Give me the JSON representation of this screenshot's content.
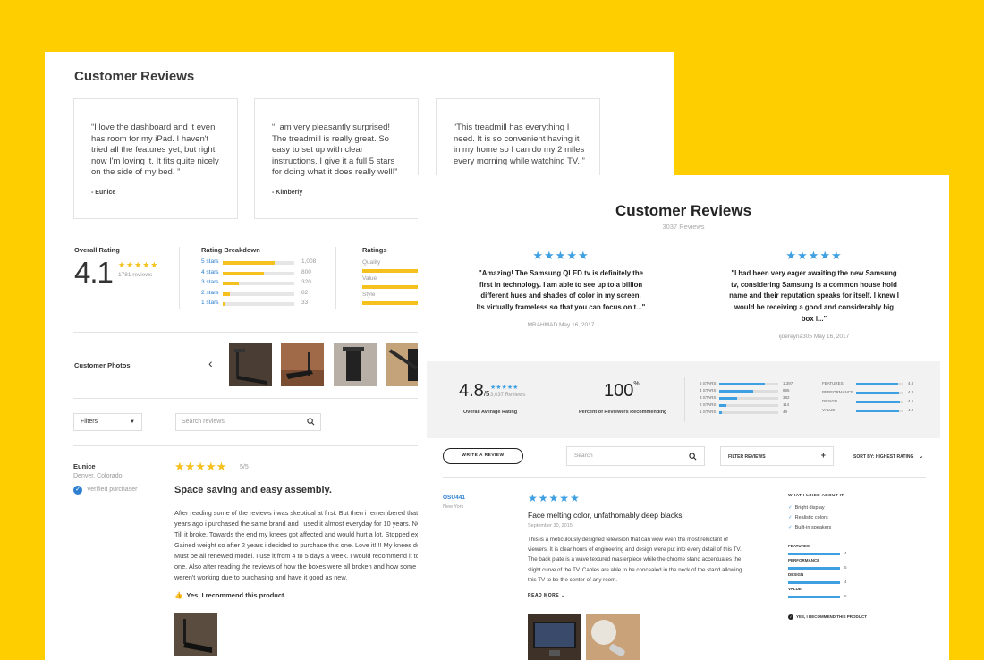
{
  "card1": {
    "title": "Customer Reviews",
    "quotes": [
      {
        "text": "“I love the dashboard and it even has room for my iPad. I haven't tried all the features yet, but right now I'm loving it. It fits quite nicely on the side of my bed. ”",
        "author": "- Eunice"
      },
      {
        "text": "“I am very pleasantly surprised! The treadmill is really great. So easy to set up with clear instructions. I give it a full 5 stars for doing what it does really well!”",
        "author": "- Kimberly"
      },
      {
        "text": "“This treadmill has everything I need. It is so convenient having it in my home so I can do my 2 miles every morning while watching TV. ”",
        "author": ""
      }
    ],
    "overall": {
      "label": "Overall Rating",
      "value": "4.1",
      "stars": "★★★★★",
      "count": "1781 reviews"
    },
    "breakdown": {
      "label": "Rating Breakdown",
      "rows": [
        {
          "label": "5 stars",
          "count": "1,008",
          "fraction": 0.72
        },
        {
          "label": "4 stars",
          "count": "800",
          "fraction": 0.57
        },
        {
          "label": "3 stars",
          "count": "320",
          "fraction": 0.23
        },
        {
          "label": "2 stars",
          "count": "82",
          "fraction": 0.1
        },
        {
          "label": "1 stars",
          "count": "33",
          "fraction": 0.03
        }
      ]
    },
    "ratings": {
      "label": "Ratings",
      "rows": [
        {
          "label": "Quality"
        },
        {
          "label": "Value"
        },
        {
          "label": "Style"
        }
      ]
    },
    "photos": {
      "label": "Customer Photos",
      "prev_icon": "‹"
    },
    "filters": {
      "label": "Filters",
      "arrow": "▼"
    },
    "search": {
      "placeholder": "Search reviews"
    },
    "review": {
      "name": "Eunice",
      "location": "Denver, Colorado",
      "verified": "Verified purchaser",
      "stars": "★★★★★",
      "score": "5/5",
      "title": "Space saving and easy assembly.",
      "body_lines": [
        "After reading some of the reviews i was skeptical at first. But then i remembered that r",
        "years ago i purchased the same brand and i used it almost everyday for 10 years. NO K",
        "Till it broke. Towards the end my knees got affected and would hurt a lot. Stopped exe",
        "Gained weight so after 2 years i decided to purchase this one. Love it!!!! My knees don'",
        "Must be all renewed model. I use it from 4 to 5 days a week. I would recommend it to e",
        "one. Also after reading the reviews of how the boxes were all broken and how some p",
        "weren't working due to purchasing and have it good as new."
      ],
      "recommend": "Yes, I recommend this product."
    }
  },
  "card2": {
    "title": "Customer Reviews",
    "subtitle": "3037 Reviews",
    "quotes": [
      {
        "stars": "★★★★★",
        "text": "\"Amazing! The Samsung QLED tv is definitely the first in technology. I am able to see up to a billion different hues and shades of color in my screen. Its virtually frameless so that you can focus on t...\"",
        "user": "MRAHMAD",
        "date": "May 16, 2017"
      },
      {
        "stars": "★★★★★",
        "text": "\"I had been very eager awaiting the new Samsung tv, considering Samsung is a common house hold name and their reputation speaks for itself. I knew I would be receiving a good and considerably big box i...\"",
        "user": "ijoereyna305",
        "date": "May 16, 2017"
      }
    ],
    "summary": {
      "avg": "4.8",
      "avg_suffix": "/5",
      "avg_stars": "★★★★★",
      "avg_count": "3,037 Reviews",
      "avg_label": "Overall Average Rating",
      "pct": "100",
      "pct_suffix": "%",
      "pct_label": "Percent of Reviewers Recommending"
    },
    "breakdown": [
      {
        "label": "5 STARS",
        "count": "1,397",
        "fraction": 0.78
      },
      {
        "label": "4 STARS",
        "count": "895",
        "fraction": 0.58
      },
      {
        "label": "3 STARS",
        "count": "382",
        "fraction": 0.3
      },
      {
        "label": "2 STARS",
        "count": "114",
        "fraction": 0.12
      },
      {
        "label": "1 STARS",
        "count": "49",
        "fraction": 0.04
      }
    ],
    "features": [
      {
        "label": "FEATURES",
        "value": "4.0",
        "fraction": 0.9
      },
      {
        "label": "PERFORMANCE",
        "value": "4.2",
        "fraction": 0.92
      },
      {
        "label": "DESIGN",
        "value": "4.5",
        "fraction": 0.95
      },
      {
        "label": "VALUE",
        "value": "4.2",
        "fraction": 0.92
      }
    ],
    "toolbar": {
      "write_review": "WRITE A REVIEW",
      "search_placeholder": "Search",
      "filter_reviews": "FILTER REVIEWS",
      "sort_by": "SORT BY:",
      "sort_value": "HIGHEST RATING"
    },
    "review": {
      "user": "OSU441",
      "location": "New York",
      "stars": "★★★★★",
      "title": "Face melting color, unfathomably deep blacks!",
      "date": "September 30, 2015",
      "body_lines": [
        "This is a meticulously designed television that can wow even the most reluctant of",
        "viewers. It is clear hours of engineering and design were put into every detail of this TV.",
        "The back plate is a wave textured masterpiece while the chrome stand accentuates the",
        "slight curve of the TV. Cables are able to be concealed in the neck of the stand allowing",
        "this TV to be the center of any room."
      ],
      "read_more": "READ MORE",
      "liked_title": "WHAT I LIKED ABOUT IT",
      "liked": [
        "Bright display",
        "Realistic colors",
        "Built-in speakers"
      ],
      "feature_ratings": [
        {
          "label": "FEATURES",
          "value": "4"
        },
        {
          "label": "PERFORMANCE",
          "value": "5"
        },
        {
          "label": "DESIGN",
          "value": "4"
        },
        {
          "label": "VALUE",
          "value": "5"
        }
      ],
      "recommend": "YES, I RECOMMEND THIS PRODUCT"
    }
  },
  "colors": {
    "background": "#ffce00",
    "star_yellow": "#f5c11e",
    "star_blue": "#3ea0e2",
    "link_blue": "#2d7fd0"
  }
}
